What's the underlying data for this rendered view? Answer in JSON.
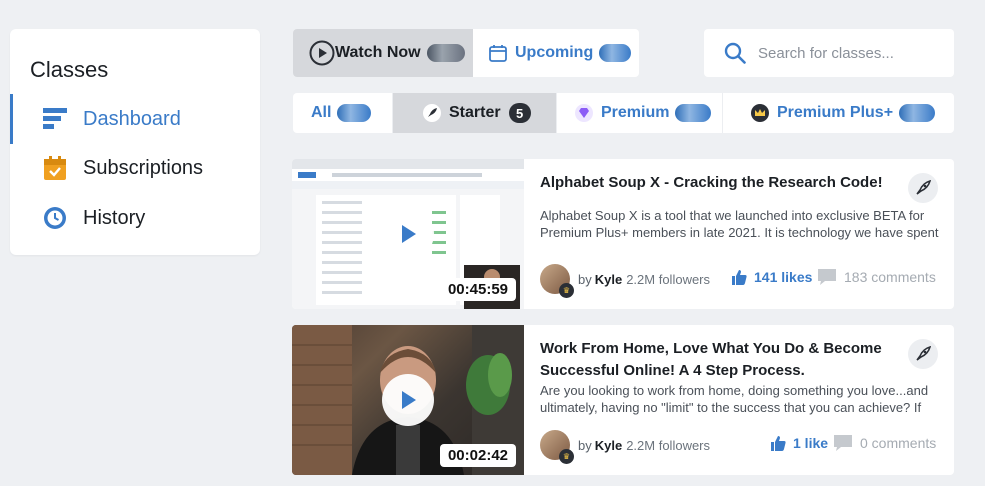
{
  "sidebar": {
    "title": "Classes",
    "items": [
      {
        "label": "Dashboard",
        "icon": "dashboard-icon",
        "active": true
      },
      {
        "label": "Subscriptions",
        "icon": "calendar-check-icon",
        "active": false
      },
      {
        "label": "History",
        "icon": "history-icon",
        "active": false
      }
    ]
  },
  "top_tabs": {
    "watch_now": "Watch Now",
    "upcoming": "Upcoming"
  },
  "search": {
    "placeholder": "Search for classes..."
  },
  "filters": {
    "all": "All",
    "starter": "Starter",
    "starter_count": "5",
    "premium": "Premium",
    "premium_plus": "Premium Plus+"
  },
  "cards": [
    {
      "title": "Alphabet Soup X - Cracking the Research Code!",
      "description": "Alphabet Soup X is a tool that we launched into exclusive BETA for Premium Plus+ members in late 2021. It is technology we have spent",
      "duration": "00:45:59",
      "author_by": "by",
      "author_name": "Kyle",
      "followers": "2.2M followers",
      "likes": "141 likes",
      "comments": "183 comments"
    },
    {
      "title": "Work From Home, Love What You Do & Become Successful Online! A 4 Step Process.",
      "description": "Are you looking to work from home, doing something you love...and ultimately, having no \"limit\" to the success that you can achieve? If you",
      "duration": "00:02:42",
      "author_by": "by",
      "author_name": "Kyle",
      "followers": "2.2M followers",
      "likes": "1 like",
      "comments": "0 comments"
    }
  ],
  "colors": {
    "accent": "#3a7bc8",
    "background": "#eef0f3",
    "active_tab": "#d6d8dc"
  }
}
